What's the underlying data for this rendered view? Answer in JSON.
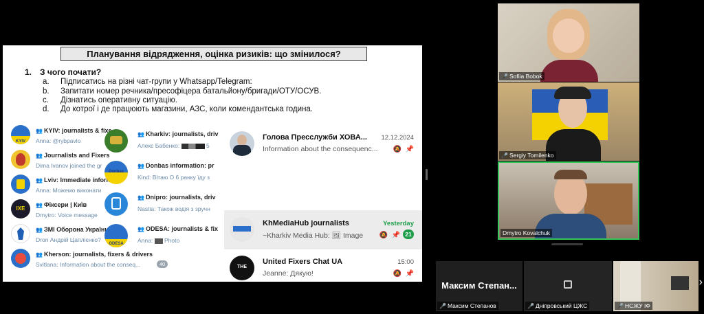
{
  "slide": {
    "title": "Планування відрядження, оцінка ризиків: що змінилося?",
    "question_num": "1.",
    "question": "З чого почати?",
    "items": [
      {
        "letter": "a.",
        "text": "Підписатись на різні чат-групи у Whatsapp/Telegram:"
      },
      {
        "letter": "b.",
        "text": "Запитати номер речника/пресофіцера батальйону/бригади/ОТУ/ОСУВ."
      },
      {
        "letter": "c.",
        "text": "Дізнатись оперативну ситуацію."
      },
      {
        "letter": "d.",
        "text": "До котрої і де працюють магазини, АЗС, коли комендантська година."
      }
    ]
  },
  "telegram_col1": [
    {
      "name": "KYIV: journalists & fixe",
      "msg": "Anna: @rybpavlo"
    },
    {
      "name": "Journalists and Fixers",
      "msg": "Dima Ivanov joined the gr"
    },
    {
      "name": "Lviv: Immediate inforn",
      "msg": "Anna: Можемо виконати"
    },
    {
      "name": "Фіксери | Київ",
      "msg": "Dmytro: Voice message"
    },
    {
      "name": "ЗМІ Оборона України",
      "msg": "Dron Андрій Цаплієнко?"
    },
    {
      "name": "Kherson: journalists, fixers & drivers",
      "msg": "Svitlana: Information about the conseq...",
      "badge": "40"
    }
  ],
  "telegram_col2": [
    {
      "name": "Kharkiv: journalists, driv",
      "msg": "Алекс Бабенко:",
      "extra": "5"
    },
    {
      "name": "Donbas information: pr",
      "msg": "Kind: Вітаю О 6 ранку їду з",
      "avatar_text": "Donbas"
    },
    {
      "name": "Dnipro: journalists, driv",
      "msg": "Nastia: Також водія з зручн"
    },
    {
      "name": "ODESA: journalists & fix",
      "msg": "Anna:",
      "extra": "Photo",
      "avatar_text": "ODESA"
    }
  ],
  "col1_avatar_texts": [
    "KYIV",
    "",
    "",
    "IXE",
    "",
    ""
  ],
  "whatsapp": [
    {
      "name": "Голова Пресслужби ХОВА...",
      "msg": "Information about the consequenc...",
      "time": "12.12.2024"
    },
    {
      "name": "KhMediaHub journalists",
      "msg": "~Kharkiv Media Hub:",
      "extra": "Image",
      "time": "Yesterday",
      "badge": "21"
    },
    {
      "name": "United Fixers Chat UA",
      "msg": "Jeanne: Дякую!",
      "time": "15:00"
    }
  ],
  "participants": {
    "p1": "Sofiia Bobok",
    "p2": "Sergiy Tomilenko",
    "p3": "Dmytro Kovalchuk",
    "s1_big": "Максим  Степан...",
    "s1": "Максим Степанов",
    "s2": "Дніпровський ЦЖС",
    "s3": "НСЖУ ІФ"
  },
  "colors": {
    "active_border": "#35c759",
    "badge_green": "#1e9e49",
    "mic_red": "#e03434"
  }
}
